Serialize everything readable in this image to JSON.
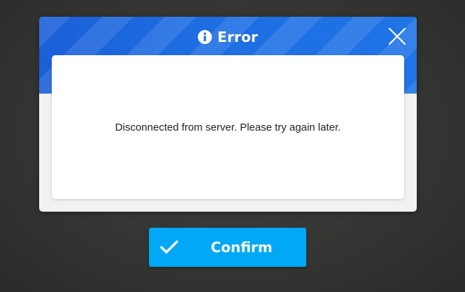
{
  "dialog": {
    "title": "Error",
    "title_icon": "info-icon",
    "close_icon": "close-icon",
    "message": "Disconnected from server. Please try again later."
  },
  "confirm": {
    "label": "Confirm",
    "icon": "checkmark-icon"
  },
  "colors": {
    "header_blue": "#1e6de3",
    "confirm_blue": "#00a8f5",
    "background": "#383836"
  }
}
